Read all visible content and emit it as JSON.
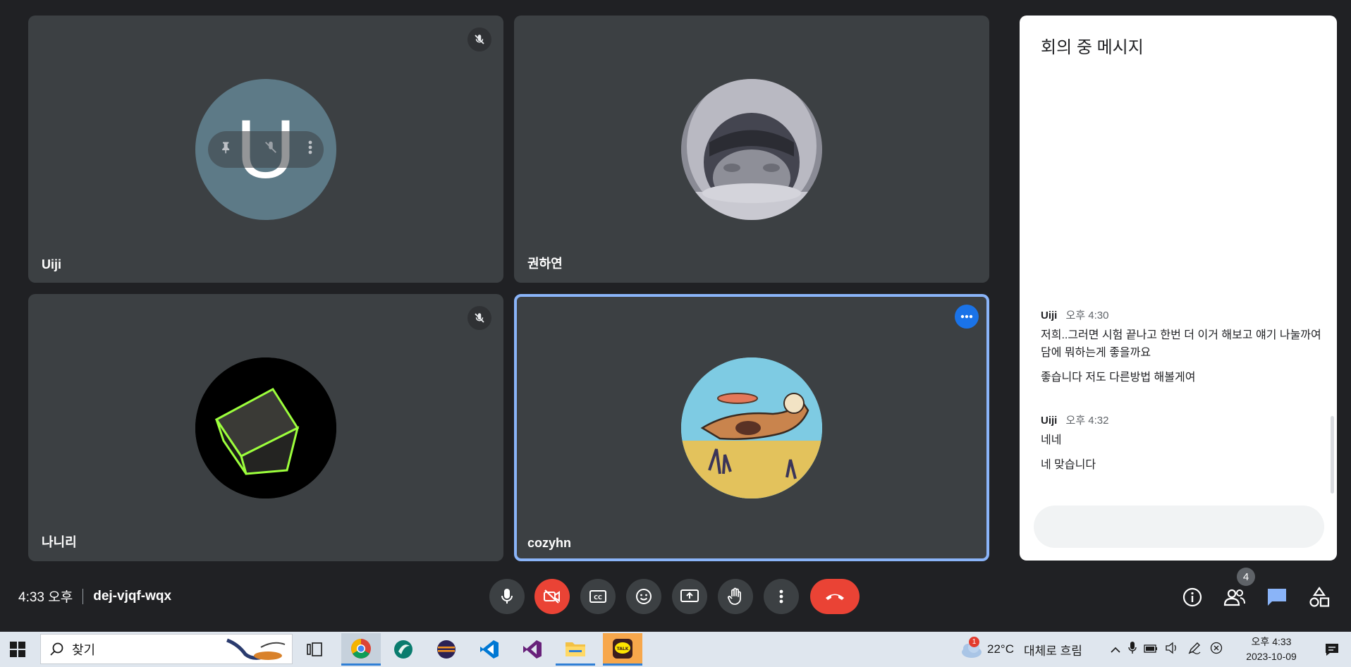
{
  "participants": [
    {
      "name": "Uiji",
      "initial": "U",
      "muted": true
    },
    {
      "name": "권하연",
      "muted": false
    },
    {
      "name": "나니리",
      "muted": true
    },
    {
      "name": "cozyhn",
      "muted": false,
      "active": true
    }
  ],
  "chat": {
    "title": "회의 중 메시지",
    "messages": [
      {
        "sender": "Uiji",
        "time": "오후 4:30",
        "lines": [
          "저희..그러면 시험 끝나고 한번 더 이거 해보고 얘기 나눌까여 담에 뭐하는게 좋을까요",
          "좋습니다 저도 다른방법 해볼게여"
        ]
      },
      {
        "sender": "Uiji",
        "time": "오후 4:32",
        "lines": [
          "네네",
          "네 맞습니다"
        ]
      }
    ]
  },
  "meeting": {
    "time": "4:33 오후",
    "code": "dej-vjqf-wqx",
    "participant_count": "4"
  },
  "controls": [
    {
      "name": "mic-button",
      "icon": "mic-icon"
    },
    {
      "name": "camera-button",
      "icon": "camera-off-icon",
      "state": "off"
    },
    {
      "name": "captions-button",
      "icon": "cc-icon"
    },
    {
      "name": "emoji-button",
      "icon": "smile-icon"
    },
    {
      "name": "present-button",
      "icon": "present-icon"
    },
    {
      "name": "raise-hand-button",
      "icon": "hand-icon"
    },
    {
      "name": "more-options-button",
      "icon": "more-vert-icon"
    },
    {
      "name": "leave-call-button",
      "icon": "phone-hangup-icon"
    }
  ],
  "taskbar": {
    "search_placeholder": "찾기",
    "weather_temp": "22°C",
    "weather_desc": "대체로 흐림",
    "weather_alert": "1",
    "clock_time": "오후 4:33",
    "clock_date": "2023-10-09"
  },
  "colors": {
    "background": "#202124",
    "tile": "#3c4043",
    "accent_blue": "#8ab4f8",
    "danger_red": "#ea4335",
    "chat_icon_blue": "#8ab4f8"
  }
}
